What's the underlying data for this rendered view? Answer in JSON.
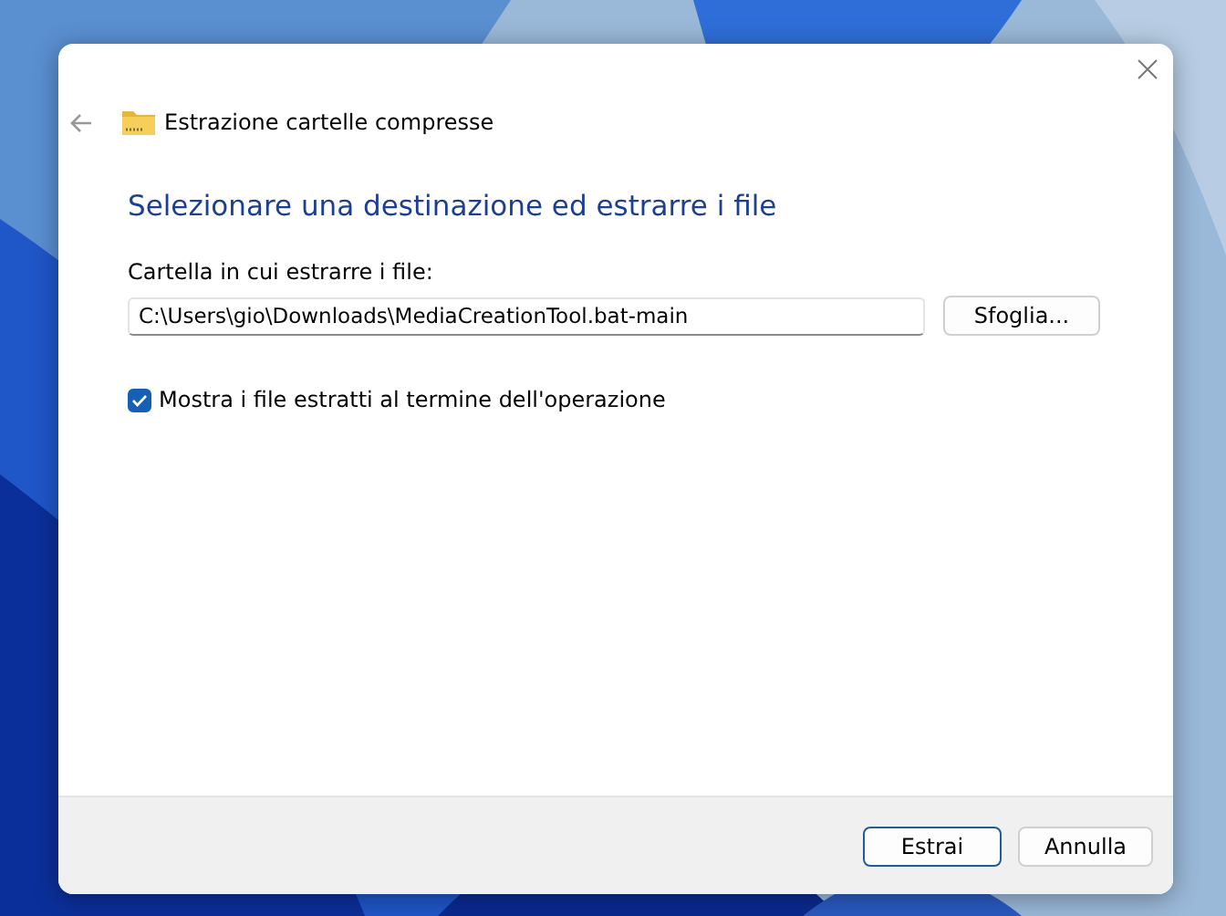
{
  "window": {
    "title": "Estrazione cartelle compresse"
  },
  "heading": "Selezionare una destinazione ed estrarre i file",
  "destination": {
    "label": "Cartella in cui estrarre i file:",
    "value": "C:\\Users\\gio\\Downloads\\MediaCreationTool.bat-main",
    "browse_button": "Sfoglia..."
  },
  "show_files": {
    "label": "Mostra i file estratti al termine dell'operazione",
    "checked": true
  },
  "buttons": [
    {
      "label": "Estrai",
      "selected": true
    },
    {
      "label": "Annulla",
      "selected": false
    }
  ]
}
